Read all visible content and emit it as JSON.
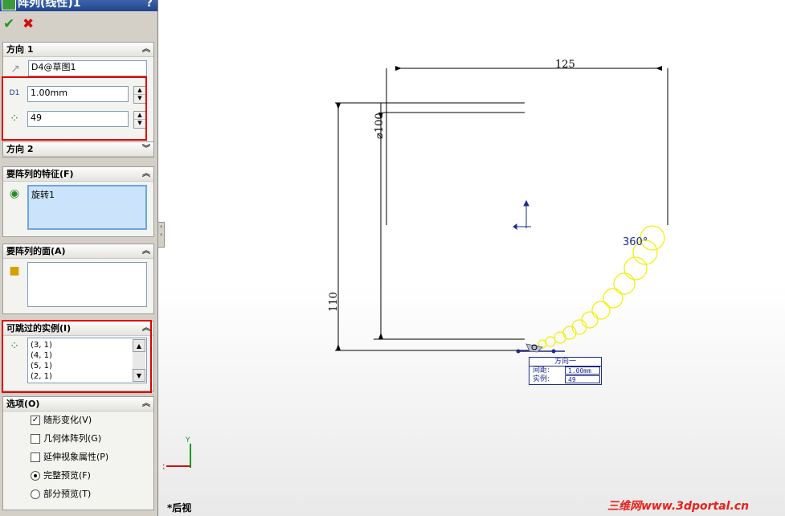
{
  "panel": {
    "title": "阵列(线性)1",
    "help": "?",
    "ok_icon": "check-icon",
    "cancel_icon": "x-icon"
  },
  "direction1": {
    "header": "方向 1",
    "reference": "D4@草图1",
    "spacing": "1.00mm",
    "instances": "49"
  },
  "direction2": {
    "header": "方向 2"
  },
  "features": {
    "header": "要阵列的特征(F)",
    "items": [
      "旋转1"
    ]
  },
  "faces": {
    "header": "要阵列的面(A)"
  },
  "skip": {
    "header": "可跳过的实例(I)",
    "items": [
      "(3, 1)",
      "(4, 1)",
      "(5, 1)",
      "(2, 1)"
    ]
  },
  "options": {
    "header": "选项(O)",
    "items": [
      {
        "label": "随形变化(V)",
        "type": "checkbox",
        "checked": true
      },
      {
        "label": "几何体阵列(G)",
        "type": "checkbox",
        "checked": false
      },
      {
        "label": "延伸视象属性(P)",
        "type": "checkbox",
        "checked": false
      },
      {
        "label": "完整预览(F)",
        "type": "radio",
        "checked": true
      },
      {
        "label": "部分预览(T)",
        "type": "radio",
        "checked": false
      }
    ]
  },
  "graphics": {
    "dim_width": "125",
    "dim_diameter": "⌀100",
    "dim_height": "110",
    "angle": "360°",
    "callout": {
      "title": "方向一",
      "spacing_label": "间距:",
      "spacing_value": "1.00mm",
      "instances_label": "实例:",
      "instances_value": "49"
    },
    "triad_x": "X",
    "triad_y": "Y",
    "view_name": "*后视",
    "watermark": "三维网www.3dportal.cn",
    "colors": {
      "preview": "#f0f000",
      "annotation": "#1e2b8a",
      "highlight": "#e00000"
    }
  }
}
